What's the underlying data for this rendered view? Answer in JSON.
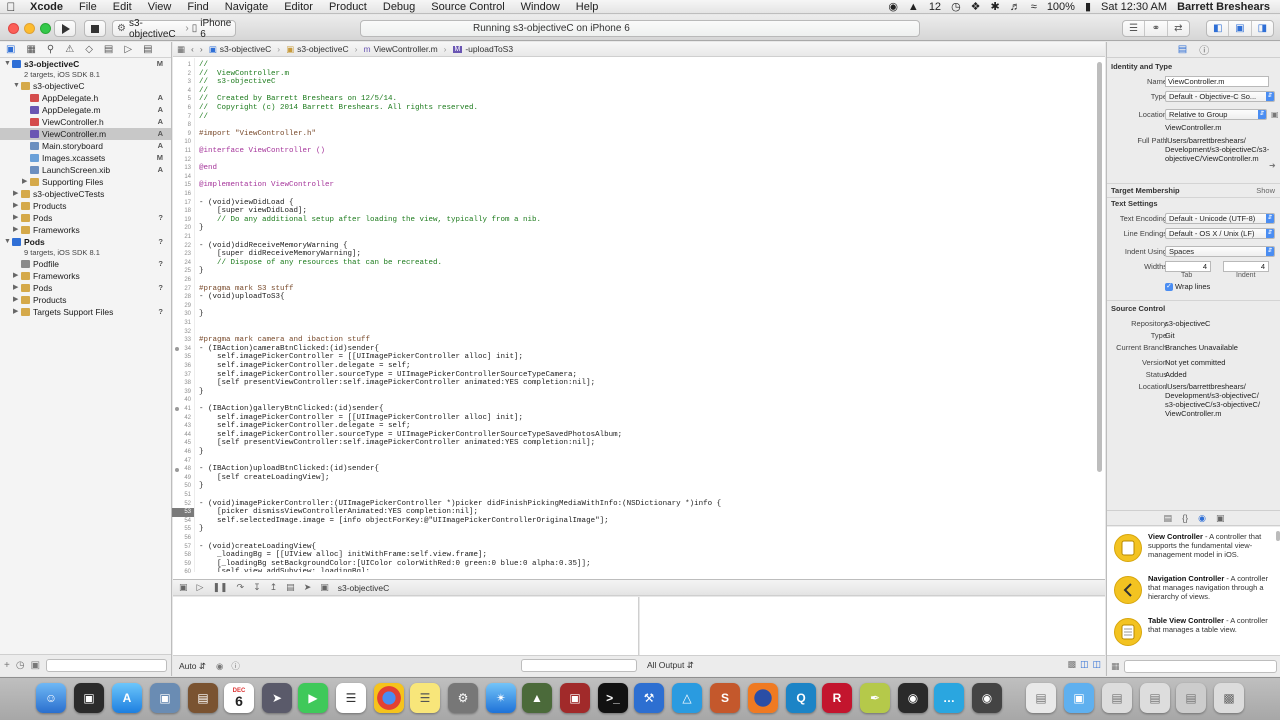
{
  "menubar": {
    "app": "Xcode",
    "items": [
      "File",
      "Edit",
      "View",
      "Find",
      "Navigate",
      "Editor",
      "Product",
      "Debug",
      "Source Control",
      "Window",
      "Help"
    ],
    "notifications": "12",
    "battery": "100%",
    "clock": "Sat 12:30 AM",
    "user": "Barrett Breshears"
  },
  "toolbar": {
    "scheme": "s3-objectiveC",
    "device": "iPhone 6",
    "activity": "Running s3-objectiveC on iPhone 6"
  },
  "navigator": {
    "rows": [
      {
        "label": "s3-objectiveC",
        "sub": "2 targets, iOS SDK 8.1",
        "status": "M",
        "kind": "project"
      },
      {
        "label": "s3-objectiveC",
        "status": "",
        "kind": "folder"
      },
      {
        "label": "AppDelegate.h",
        "status": "A",
        "kind": "h"
      },
      {
        "label": "AppDelegate.m",
        "status": "A",
        "kind": "m"
      },
      {
        "label": "ViewController.h",
        "status": "A",
        "kind": "h"
      },
      {
        "label": "ViewController.m",
        "status": "A",
        "kind": "m"
      },
      {
        "label": "Main.storyboard",
        "status": "A",
        "kind": "sb"
      },
      {
        "label": "Images.xcassets",
        "status": "M",
        "kind": "assets"
      },
      {
        "label": "LaunchScreen.xib",
        "status": "A",
        "kind": "xib"
      },
      {
        "label": "Supporting Files",
        "status": "",
        "kind": "folder"
      },
      {
        "label": "s3-objectiveCTests",
        "status": "",
        "kind": "folder"
      },
      {
        "label": "Products",
        "status": "",
        "kind": "folder"
      },
      {
        "label": "Pods",
        "status": "?",
        "kind": "folder"
      },
      {
        "label": "Frameworks",
        "status": "",
        "kind": "folder"
      },
      {
        "label": "Pods",
        "sub": "9 targets, iOS SDK 8.1",
        "status": "?",
        "kind": "project"
      },
      {
        "label": "Podfile",
        "status": "?",
        "kind": "file"
      },
      {
        "label": "Frameworks",
        "status": "",
        "kind": "folder"
      },
      {
        "label": "Pods",
        "status": "?",
        "kind": "folder"
      },
      {
        "label": "Products",
        "status": "",
        "kind": "folder"
      },
      {
        "label": "Targets Support Files",
        "status": "?",
        "kind": "folder"
      }
    ]
  },
  "jumpbar": {
    "project": "s3-objectiveC",
    "group": "s3-objectiveC",
    "file": "ViewController.m",
    "symbol": "-uploadToS3"
  },
  "code": {
    "lines": [
      {
        "n": 1,
        "t": "//",
        "c": "com"
      },
      {
        "n": 2,
        "t": "//  ViewController.m",
        "c": "com"
      },
      {
        "n": 3,
        "t": "//  s3-objectiveC",
        "c": "com"
      },
      {
        "n": 4,
        "t": "//",
        "c": "com"
      },
      {
        "n": 5,
        "t": "//  Created by Barrett Breshears on 12/5/14.",
        "c": "com"
      },
      {
        "n": 6,
        "t": "//  Copyright (c) 2014 Barrett Breshears. All rights reserved.",
        "c": "com"
      },
      {
        "n": 7,
        "t": "//",
        "c": "com"
      },
      {
        "n": 8,
        "t": "",
        "c": ""
      },
      {
        "n": 9,
        "t": "#import \"ViewController.h\"",
        "c": "pp"
      },
      {
        "n": 10,
        "t": "",
        "c": ""
      },
      {
        "n": 11,
        "t": "@interface ViewController ()",
        "c": "kw"
      },
      {
        "n": 12,
        "t": "",
        "c": ""
      },
      {
        "n": 13,
        "t": "@end",
        "c": "kw"
      },
      {
        "n": 14,
        "t": "",
        "c": ""
      },
      {
        "n": 15,
        "t": "@implementation ViewController",
        "c": "kw"
      },
      {
        "n": 16,
        "t": "",
        "c": ""
      },
      {
        "n": 17,
        "t": "- (void)viewDidLoad {",
        "c": ""
      },
      {
        "n": 18,
        "t": "    [super viewDidLoad];",
        "c": ""
      },
      {
        "n": 19,
        "t": "    // Do any additional setup after loading the view, typically from a nib.",
        "c": "com"
      },
      {
        "n": 20,
        "t": "}",
        "c": ""
      },
      {
        "n": 21,
        "t": "",
        "c": ""
      },
      {
        "n": 22,
        "t": "- (void)didReceiveMemoryWarning {",
        "c": ""
      },
      {
        "n": 23,
        "t": "    [super didReceiveMemoryWarning];",
        "c": ""
      },
      {
        "n": 24,
        "t": "    // Dispose of any resources that can be recreated.",
        "c": "com"
      },
      {
        "n": 25,
        "t": "}",
        "c": ""
      },
      {
        "n": 26,
        "t": "",
        "c": ""
      },
      {
        "n": 27,
        "t": "#pragma mark S3 stuff",
        "c": "pp"
      },
      {
        "n": 28,
        "t": "- (void)uploadToS3{",
        "c": ""
      },
      {
        "n": 29,
        "t": "",
        "c": ""
      },
      {
        "n": 30,
        "t": "}",
        "c": ""
      },
      {
        "n": 31,
        "t": "",
        "c": ""
      },
      {
        "n": 32,
        "t": "",
        "c": ""
      },
      {
        "n": 33,
        "t": "#pragma mark camera and ibaction stuff",
        "c": "pp"
      },
      {
        "n": 34,
        "t": "- (IBAction)cameraBtnClicked:(id)sender{",
        "c": ""
      },
      {
        "n": 35,
        "t": "    self.imagePickerController = [[UIImagePickerController alloc] init];",
        "c": ""
      },
      {
        "n": 36,
        "t": "    self.imagePickerController.delegate = self;",
        "c": ""
      },
      {
        "n": 37,
        "t": "    self.imagePickerController.sourceType = UIImagePickerControllerSourceTypeCamera;",
        "c": ""
      },
      {
        "n": 38,
        "t": "    [self presentViewController:self.imagePickerController animated:YES completion:nil];",
        "c": ""
      },
      {
        "n": 39,
        "t": "}",
        "c": ""
      },
      {
        "n": 40,
        "t": "",
        "c": ""
      },
      {
        "n": 41,
        "t": "- (IBAction)galleryBtnClicked:(id)sender{",
        "c": ""
      },
      {
        "n": 42,
        "t": "    self.imagePickerController = [[UIImagePickerController alloc] init];",
        "c": ""
      },
      {
        "n": 43,
        "t": "    self.imagePickerController.delegate = self;",
        "c": ""
      },
      {
        "n": 44,
        "t": "    self.imagePickerController.sourceType = UIImagePickerControllerSourceTypeSavedPhotosAlbum;",
        "c": ""
      },
      {
        "n": 45,
        "t": "    [self presentViewController:self.imagePickerController animated:YES completion:nil];",
        "c": ""
      },
      {
        "n": 46,
        "t": "}",
        "c": ""
      },
      {
        "n": 47,
        "t": "",
        "c": ""
      },
      {
        "n": 48,
        "t": "- (IBAction)uploadBtnClicked:(id)sender{",
        "c": ""
      },
      {
        "n": 49,
        "t": "    [self createLoadingView];",
        "c": ""
      },
      {
        "n": 50,
        "t": "}",
        "c": ""
      },
      {
        "n": 51,
        "t": "",
        "c": ""
      },
      {
        "n": 52,
        "t": "- (void)imagePickerController:(UIImagePickerController *)picker didFinishPickingMediaWithInfo:(NSDictionary *)info {",
        "c": ""
      },
      {
        "n": 53,
        "t": "    [picker dismissViewControllerAnimated:YES completion:nil];",
        "c": ""
      },
      {
        "n": 54,
        "t": "    self.selectedImage.image = [info objectForKey:@\"UIImagePickerControllerOriginalImage\"];",
        "c": ""
      },
      {
        "n": 55,
        "t": "}",
        "c": ""
      },
      {
        "n": 56,
        "t": "",
        "c": ""
      },
      {
        "n": 57,
        "t": "- (void)createLoadingView{",
        "c": ""
      },
      {
        "n": 58,
        "t": "    _loadingBg = [[UIView alloc] initWithFrame:self.view.frame];",
        "c": ""
      },
      {
        "n": 59,
        "t": "    [_loadingBg setBackgroundColor:[UIColor colorWithRed:0 green:0 blue:0 alpha:0.35]];",
        "c": ""
      },
      {
        "n": 60,
        "t": "    [self.view addSubview:_loadingBg];",
        "c": ""
      }
    ],
    "current_line": 53,
    "breakpoint_lines": [
      34,
      41,
      48
    ]
  },
  "debug": {
    "target": "s3-objectiveC",
    "auto_label": "Auto",
    "output_label": "All Output"
  },
  "inspector": {
    "identity_header": "Identity and Type",
    "name_label": "Name",
    "name_value": "ViewController.m",
    "type_label": "Type",
    "type_value": "Default - Objective-C So...",
    "location_label": "Location",
    "location_value": "Relative to Group",
    "location_file": "ViewController.m",
    "fullpath_label": "Full Path",
    "fullpath_lines": [
      "/Users/barrettbreshears/",
      "Development/s3-objectiveC/s3-",
      "objectiveC/ViewController.m"
    ],
    "membership_header": "Target Membership",
    "show_label": "Show",
    "text_settings_header": "Text Settings",
    "encoding_label": "Text Encoding",
    "encoding_value": "Default - Unicode (UTF-8)",
    "line_endings_label": "Line Endings",
    "line_endings_value": "Default - OS X / Unix (LF)",
    "indent_using_label": "Indent Using",
    "indent_using_value": "Spaces",
    "widths_label": "Widths",
    "tab_value": "4",
    "indent_value": "4",
    "tab_label": "Tab",
    "indent_label": "Indent",
    "wrap_label": "Wrap lines",
    "source_control_header": "Source Control",
    "repository_label": "Repository",
    "repository_value": "s3-objectiveC",
    "sc_type_label": "Type",
    "sc_type_value": "Git",
    "branch_label": "Current Branch",
    "branch_value": "Branches Unavailable",
    "version_label": "Version",
    "version_value": "Not yet committed",
    "status_label": "Status",
    "status_value": "Added",
    "sc_location_label": "Location",
    "sc_location_lines": [
      "/Users/barrettbreshears/",
      "Development/s3-objectiveC/",
      "s3-objectiveC/s3-objectiveC/",
      "ViewController.m"
    ]
  },
  "library": {
    "items": [
      {
        "title": "View Controller",
        "desc": " - A controller that supports the fundamental view-management model in iOS."
      },
      {
        "title": "Navigation Controller",
        "desc": " - A controller that manages navigation through a hierarchy of views."
      },
      {
        "title": "Table View Controller",
        "desc": " - A controller that manages a table view."
      }
    ]
  },
  "dock": {
    "calendar_day": "6",
    "calendar_month": "DEC"
  },
  "colors": {
    "accent": "#2f6fd6",
    "comment": "#1b7a1b",
    "keyword": "#a5349a",
    "preprocessor": "#78492a"
  }
}
